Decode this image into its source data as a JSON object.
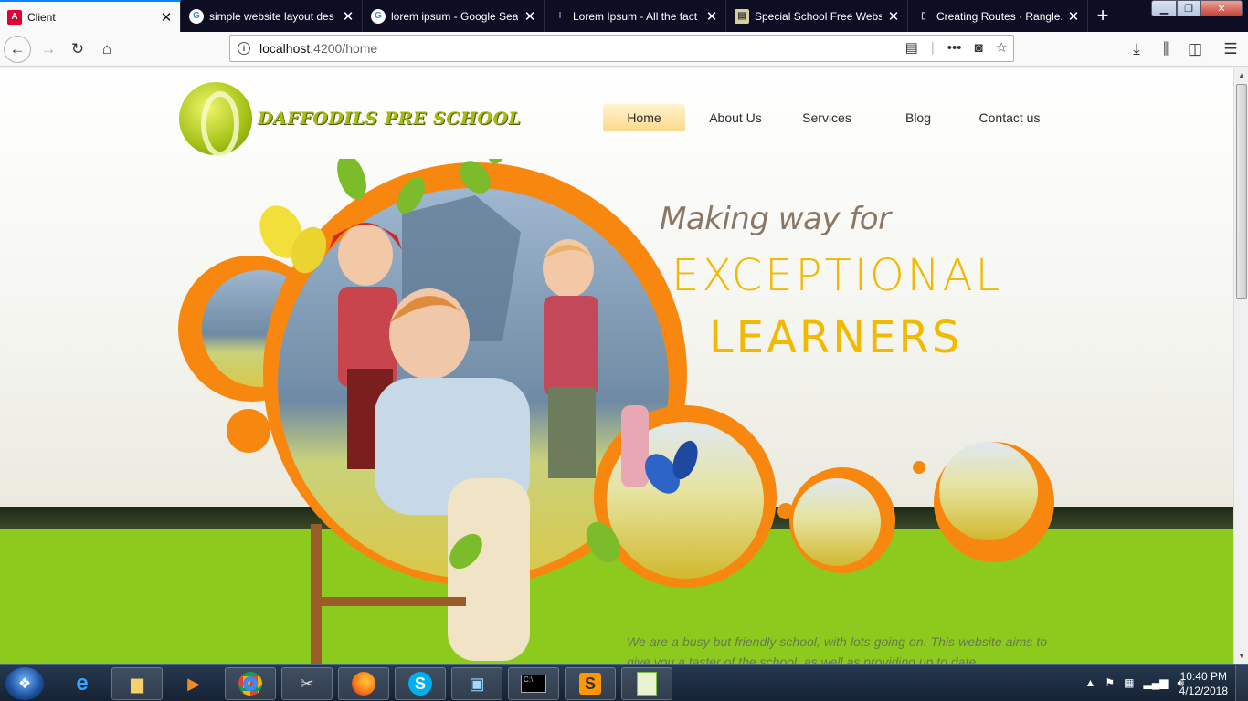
{
  "browser": {
    "tabs": [
      {
        "title": "Client",
        "favicon": "angular-icon",
        "active": true
      },
      {
        "title": "simple website layout des",
        "favicon": "google-icon"
      },
      {
        "title": "lorem ipsum - Google Sea",
        "favicon": "google-icon"
      },
      {
        "title": "Lorem Ipsum - All the fact",
        "favicon": "lorem-icon"
      },
      {
        "title": "Special School Free Websi",
        "favicon": "page-icon"
      },
      {
        "title": "Creating Routes · Rangle.i",
        "favicon": "book-icon"
      }
    ],
    "url_host": "localhost",
    "url_path": ":4200/home"
  },
  "site": {
    "logo_text": "DAFFODILS PRE SCHOOL",
    "menu": [
      "Home",
      "About Us",
      "Services",
      "Blog",
      "Contact us"
    ],
    "tagline": "Making way for",
    "headline_1": "EXCEPTIONAL",
    "headline_2": "LEARNERS",
    "intro": "We are a busy but friendly school, with lots going on. This website aims to give you a taster of the school, as well as providing up to date"
  },
  "taskbar": {
    "time": "10:40 PM",
    "date": "4/12/2018"
  },
  "colors": {
    "orange": "#f7870f",
    "green": "#8ccb1d",
    "headline": "#f1ba00"
  }
}
